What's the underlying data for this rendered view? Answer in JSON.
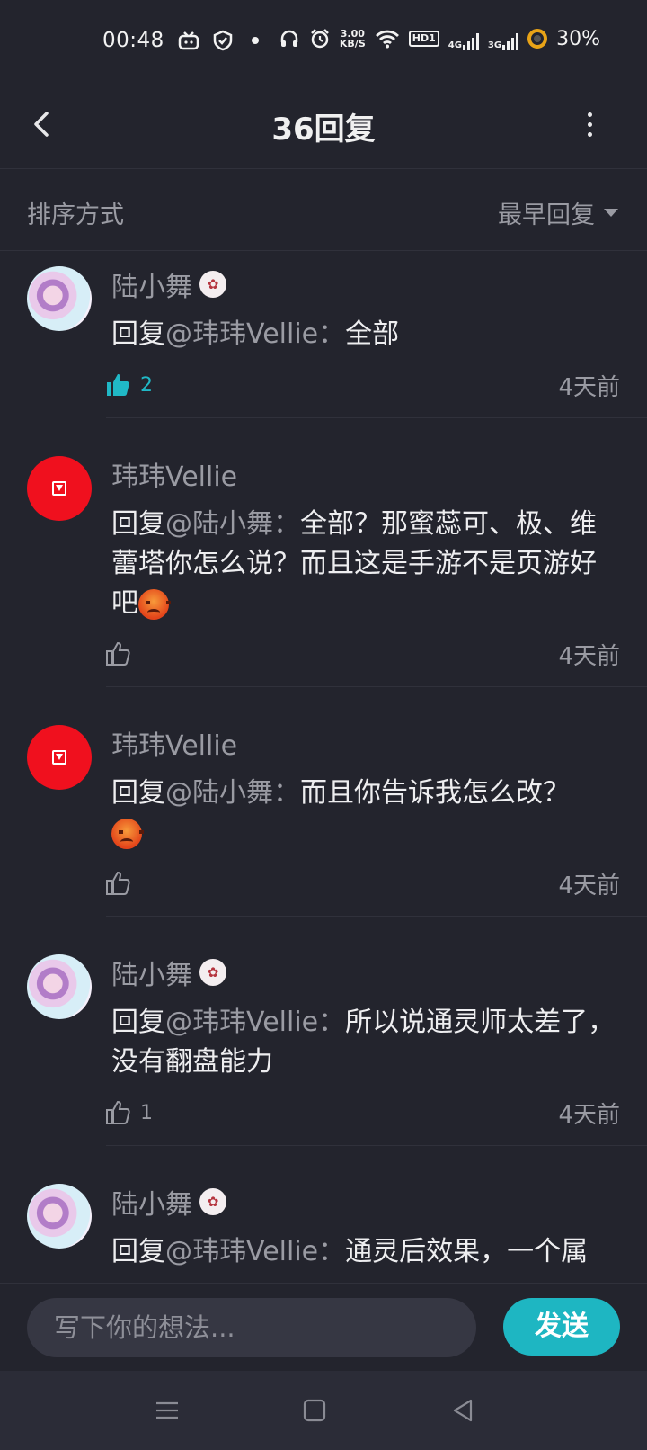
{
  "status_bar": {
    "time": "00:48",
    "net_speed_value": "3.00",
    "net_speed_unit": "KB/S",
    "hd_label": "HD1",
    "net1": "4G",
    "net2": "3G",
    "battery": "30%",
    "icons": [
      "tv-icon",
      "shield-icon",
      "dot-icon",
      "headphones-icon",
      "alarm-icon",
      "wifi-icon",
      "signal-icon",
      "battery-icon"
    ]
  },
  "nav": {
    "title": "36回复",
    "back_icon": "chevron-left-icon",
    "more_icon": "more-vertical-icon"
  },
  "sort": {
    "label": "排序方式",
    "selected": "最早回复"
  },
  "comments": [
    {
      "username": "陆小舞",
      "has_badge": true,
      "avatar": "anime",
      "prefix": "回复",
      "mention": "@玮玮Vellie",
      "sep": "：",
      "text": "全部",
      "emoji": false,
      "likes": "2",
      "liked": true,
      "time": "4天前"
    },
    {
      "username": "玮玮Vellie",
      "has_badge": false,
      "avatar": "red",
      "prefix": "回复",
      "mention": "@陆小舞",
      "sep": "：",
      "text": "全部？那蜜蕊可、极、维蕾塔你怎么说？而且这是手游不是页游好吧",
      "emoji": true,
      "likes": "",
      "liked": false,
      "time": "4天前"
    },
    {
      "username": "玮玮Vellie",
      "has_badge": false,
      "avatar": "red",
      "prefix": "回复",
      "mention": "@陆小舞",
      "sep": "：",
      "text": "而且你告诉我怎么改？",
      "emoji": true,
      "likes": "",
      "liked": false,
      "time": "4天前"
    },
    {
      "username": "陆小舞",
      "has_badge": true,
      "avatar": "anime",
      "prefix": "回复",
      "mention": "@玮玮Vellie",
      "sep": "：",
      "text": "所以说通灵师太差了，没有翻盘能力",
      "emoji": false,
      "likes": "1",
      "liked": false,
      "time": "4天前"
    },
    {
      "username": "陆小舞",
      "has_badge": true,
      "avatar": "anime",
      "prefix": "回复",
      "mention": "@玮玮Vellie",
      "sep": "：",
      "text": "通灵后效果，一个属",
      "emoji": false,
      "likes": "",
      "liked": false,
      "time": ""
    }
  ],
  "input": {
    "placeholder": "写下你的想法...",
    "send_label": "发送"
  },
  "colors": {
    "background": "#23242d",
    "accent": "#1eb6c2",
    "muted_text": "#9a9ba3"
  }
}
